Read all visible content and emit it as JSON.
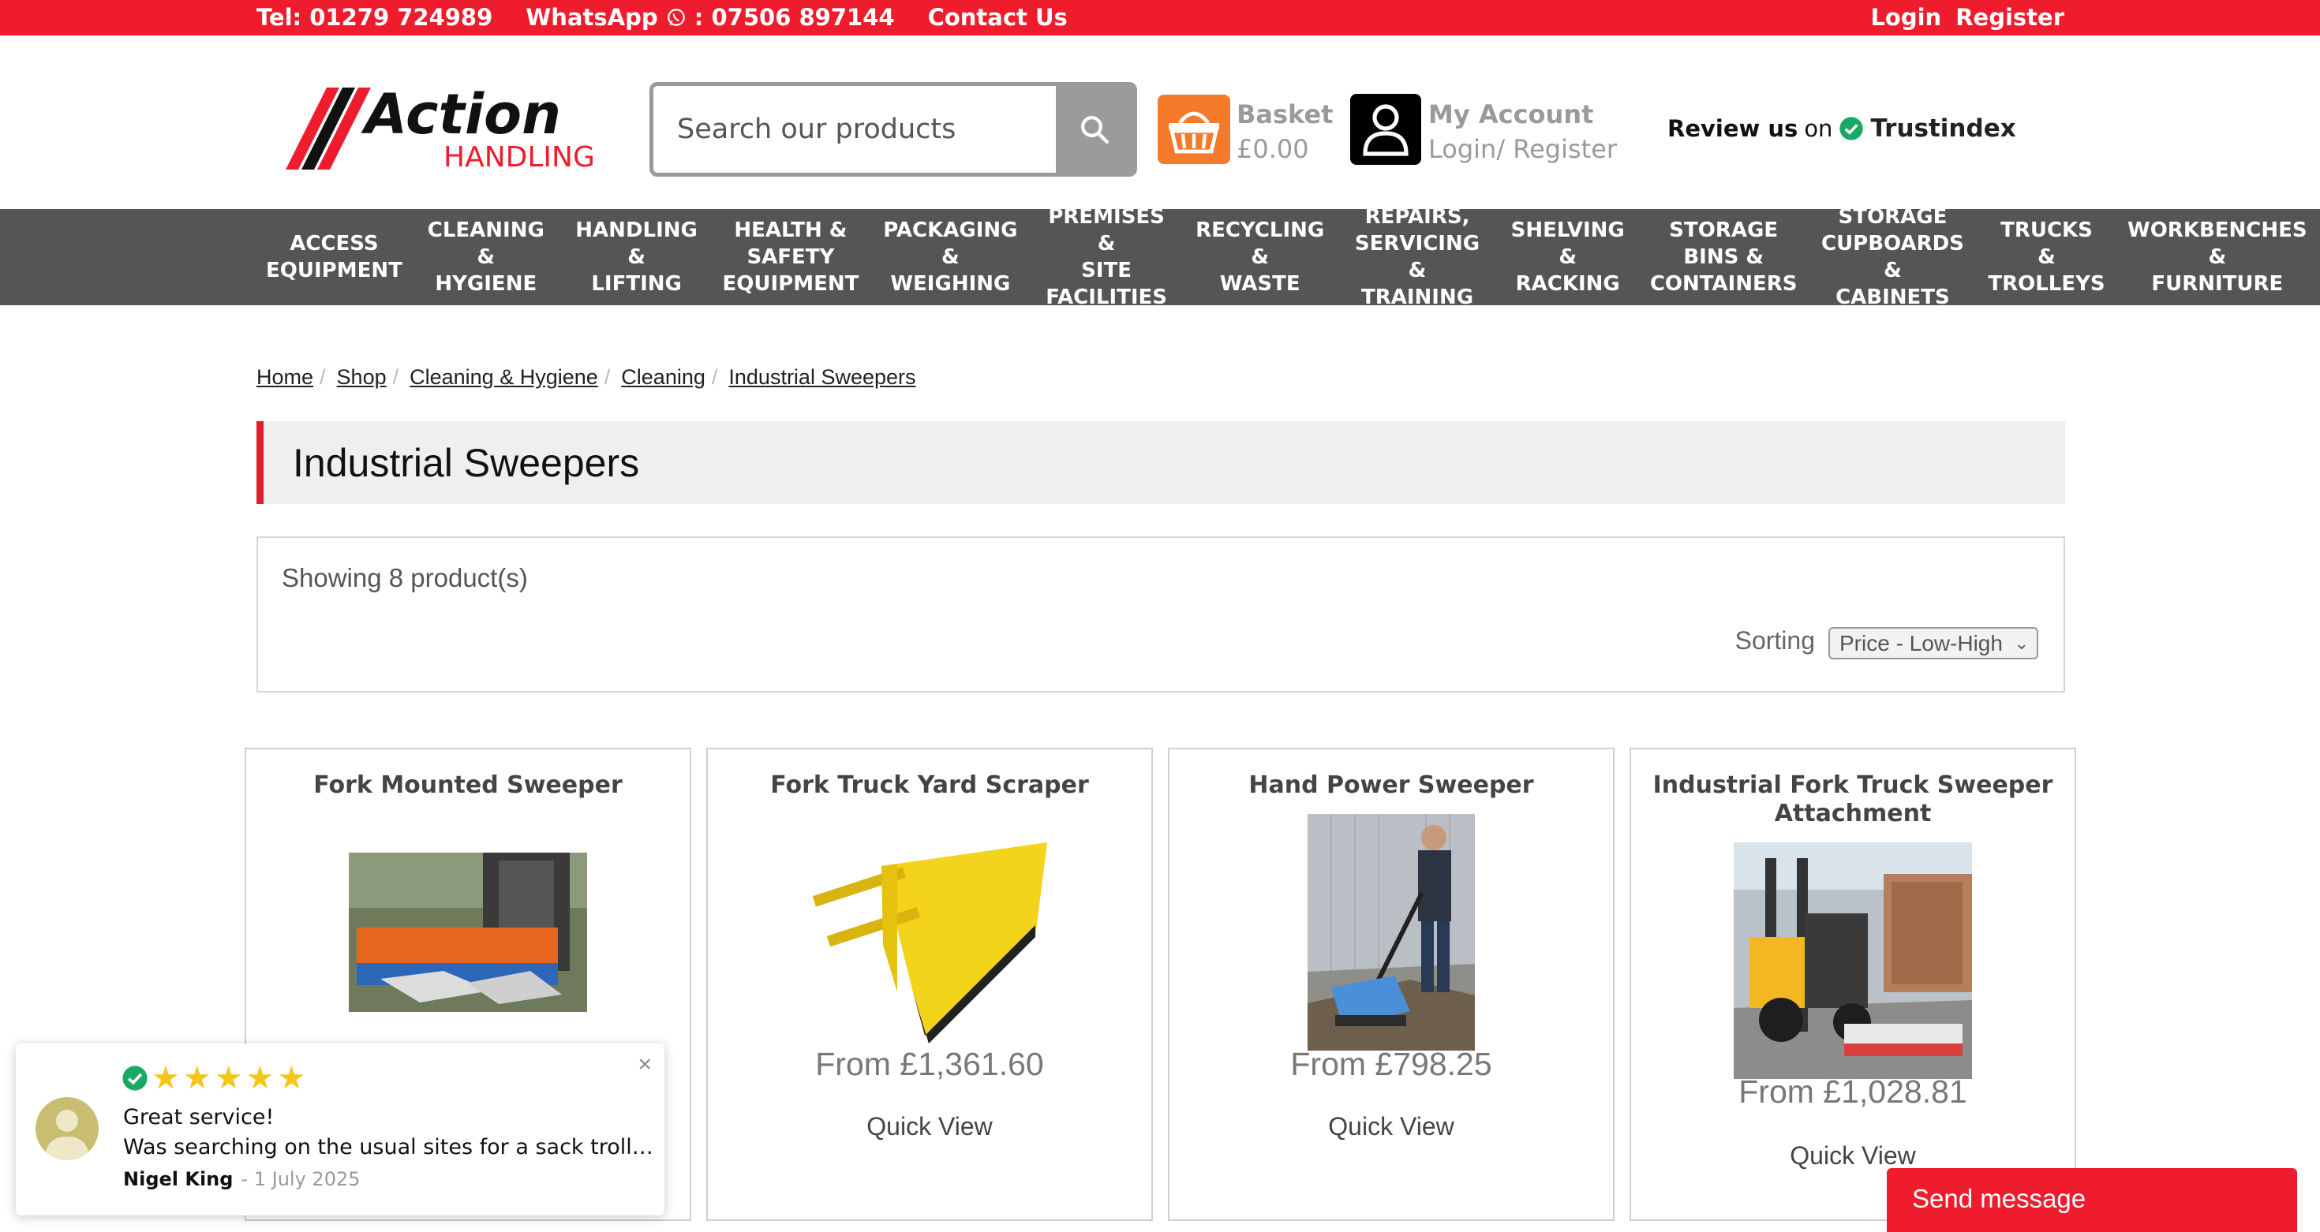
{
  "topbar": {
    "tel": "Tel: 01279 724989",
    "whatsapp_prefix": "WhatsApp",
    "whatsapp_number": " : 07506 897144",
    "contact": "Contact Us",
    "login": "Login",
    "register": "Register"
  },
  "logo": {
    "word1": "Action",
    "word2": "HANDLING"
  },
  "search": {
    "placeholder": "Search our products"
  },
  "basket": {
    "label": "Basket",
    "total": "£0.00"
  },
  "account": {
    "label": "My Account",
    "sub": "Login/ Register"
  },
  "review": {
    "prefix": "Review us",
    "on": "on",
    "brand": "Trustindex"
  },
  "nav": [
    {
      "label": "ACCESS\nEQUIPMENT"
    },
    {
      "label": "CLEANING &\nHYGIENE"
    },
    {
      "label": "HANDLING &\nLIFTING"
    },
    {
      "label": "HEALTH &\nSAFETY\nEQUIPMENT"
    },
    {
      "label": "PACKAGING &\nWEIGHING"
    },
    {
      "label": "PREMISES &\nSITE\nFACILITIES"
    },
    {
      "label": "RECYCLING &\nWASTE"
    },
    {
      "label": "REPAIRS,\nSERVICING &\nTRAINING"
    },
    {
      "label": "SHELVING &\nRACKING"
    },
    {
      "label": "STORAGE\nBINS &\nCONTAINERS"
    },
    {
      "label": "STORAGE\nCUPBOARDS &\nCABINETS"
    },
    {
      "label": "TRUCKS &\nTROLLEYS"
    },
    {
      "label": "WORKBENCHES &\nFURNITURE"
    }
  ],
  "breadcrumb": [
    "Home",
    "Shop",
    "Cleaning & Hygiene",
    "Cleaning",
    "Industrial Sweepers"
  ],
  "page_title": "Industrial Sweepers",
  "listing": {
    "count_text": "Showing 8 product(s)",
    "sort_label": "Sorting",
    "sort_value": "Price - Low-High"
  },
  "products": [
    {
      "name": "Fork Mounted Sweeper",
      "price": "",
      "quick_view": ""
    },
    {
      "name": "Fork Truck Yard Scraper",
      "price": "From £1,361.60",
      "quick_view": "Quick View"
    },
    {
      "name": "Hand Power Sweeper",
      "price": "From £798.25",
      "quick_view": "Quick View"
    },
    {
      "name": "Industrial Fork Truck Sweeper Attachment",
      "price": "From £1,028.81",
      "quick_view": "Quick View"
    }
  ],
  "review_popup": {
    "headline": "Great service!",
    "body": "Was searching on the usual sites for a sack trolley and they were all much more expensive",
    "author": "Nigel King",
    "date": "- 1 July 2025",
    "close": "×"
  },
  "send_message": "Send message",
  "colors": {
    "brand_red": "#ee1c2c",
    "nav_grey": "#555555",
    "basket_orange": "#f47b2a",
    "trustindex_green": "#1aa865"
  }
}
